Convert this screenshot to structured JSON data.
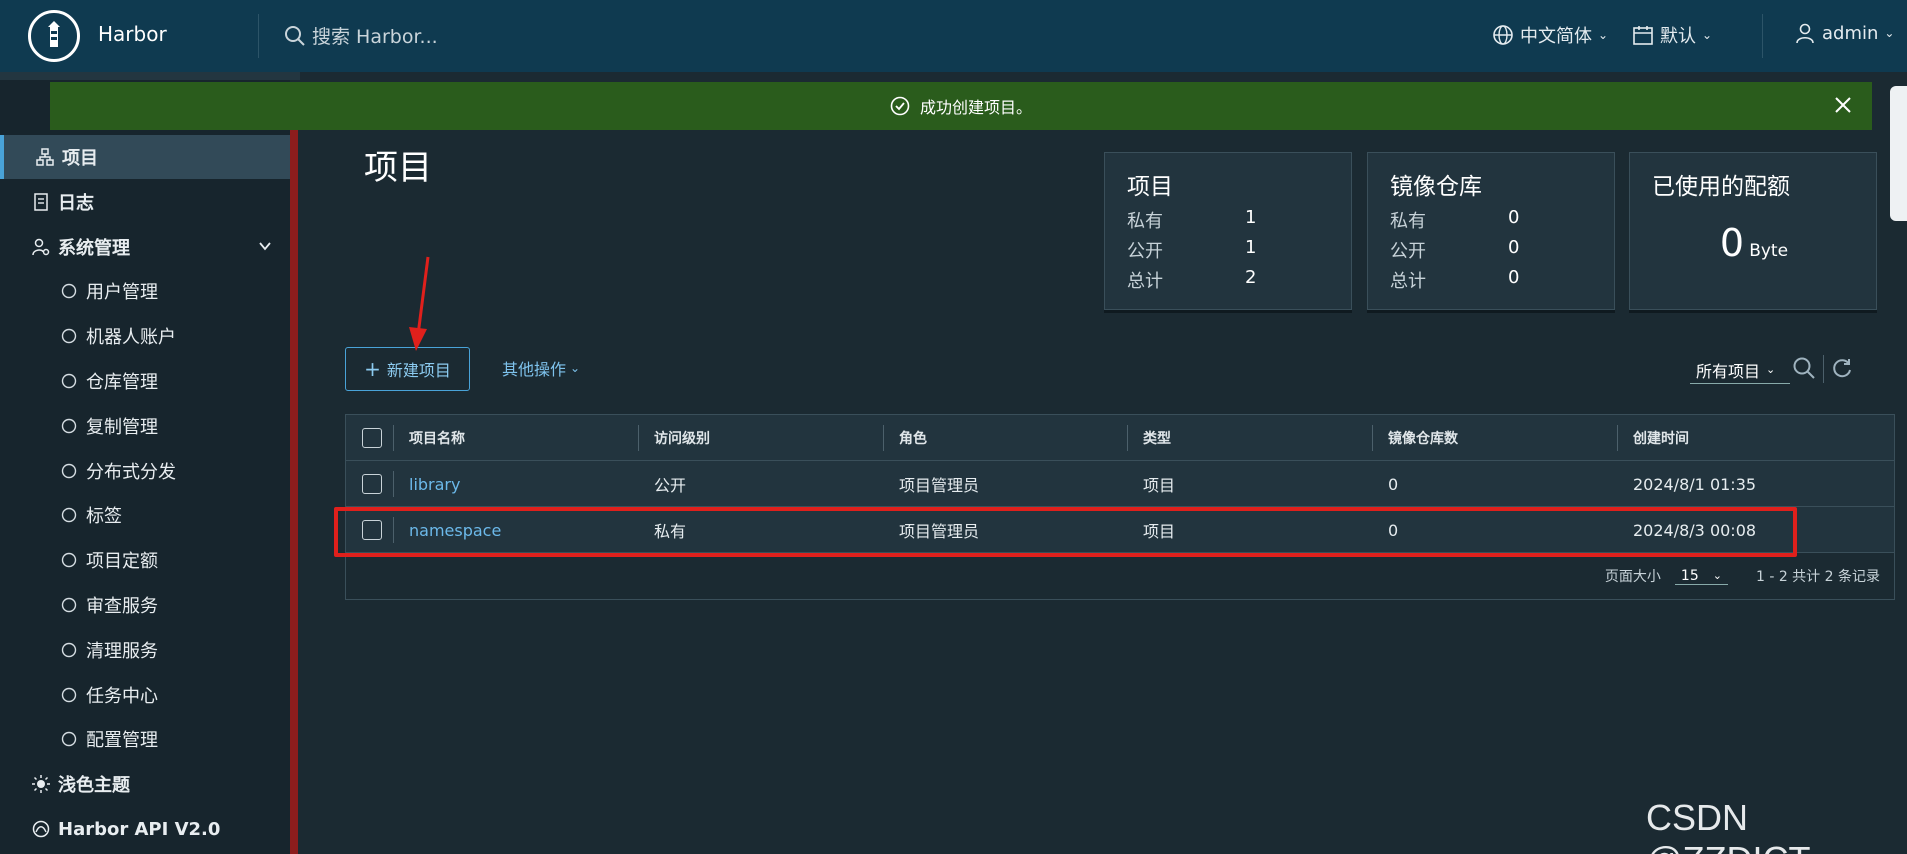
{
  "header": {
    "brand": "Harbor",
    "search_placeholder": "搜索 Harbor...",
    "language": "中文简体",
    "theme": "默认",
    "user": "admin"
  },
  "toast": {
    "message": "成功创建项目。"
  },
  "sidebar": {
    "items": [
      {
        "label": "项目",
        "icon": "projects-icon",
        "level": "top",
        "active": true
      },
      {
        "label": "日志",
        "icon": "logs-icon",
        "level": "top"
      },
      {
        "label": "系统管理",
        "icon": "admin-icon",
        "level": "top",
        "expanded": true
      },
      {
        "label": "用户管理",
        "icon": "users-icon",
        "level": "sub"
      },
      {
        "label": "机器人账户",
        "icon": "robot-icon",
        "level": "sub"
      },
      {
        "label": "仓库管理",
        "icon": "registry-icon",
        "level": "sub"
      },
      {
        "label": "复制管理",
        "icon": "replication-icon",
        "level": "sub"
      },
      {
        "label": "分布式分发",
        "icon": "share-icon",
        "level": "sub"
      },
      {
        "label": "标签",
        "icon": "tag-icon",
        "level": "sub"
      },
      {
        "label": "项目定额",
        "icon": "quota-icon",
        "level": "sub"
      },
      {
        "label": "审查服务",
        "icon": "shield-icon",
        "level": "sub"
      },
      {
        "label": "清理服务",
        "icon": "trash-icon",
        "level": "sub"
      },
      {
        "label": "任务中心",
        "icon": "dashboard-icon",
        "level": "sub"
      },
      {
        "label": "配置管理",
        "icon": "gear-icon",
        "level": "sub"
      },
      {
        "label": "浅色主题",
        "icon": "sun-icon",
        "level": "top"
      },
      {
        "label": "Harbor API V2.0",
        "icon": "api-icon",
        "level": "top"
      }
    ]
  },
  "main": {
    "title": "项目",
    "cards": {
      "projects": {
        "title": "项目",
        "rows": [
          {
            "label": "私有",
            "value": "1"
          },
          {
            "label": "公开",
            "value": "1"
          },
          {
            "label": "总计",
            "value": "2"
          }
        ]
      },
      "repos": {
        "title": "镜像仓库",
        "rows": [
          {
            "label": "私有",
            "value": "0"
          },
          {
            "label": "公开",
            "value": "0"
          },
          {
            "label": "总计",
            "value": "0"
          }
        ]
      },
      "quota": {
        "title": "已使用的配额",
        "value": "0",
        "unit": "Byte"
      }
    },
    "new_project_label": "新建项目",
    "other_actions_label": "其他操作",
    "filter_label": "所有项目",
    "table": {
      "headers": [
        "项目名称",
        "访问级别",
        "角色",
        "类型",
        "镜像仓库数",
        "创建时间"
      ],
      "rows": [
        [
          "library",
          "公开",
          "项目管理员",
          "项目",
          "0",
          "2024/8/1 01:35"
        ],
        [
          "namespace",
          "私有",
          "项目管理员",
          "项目",
          "0",
          "2024/8/3 00:08"
        ]
      ],
      "page_size_label": "页面大小",
      "page_size": "15",
      "summary": "1 - 2 共计 2 条记录"
    }
  },
  "watermark": "CSDN @ZZDICT",
  "colors": {
    "header": "#0f3a50",
    "toast": "#2a5c1c",
    "accent": "#49a3d8",
    "highlight": "#e0201c"
  }
}
